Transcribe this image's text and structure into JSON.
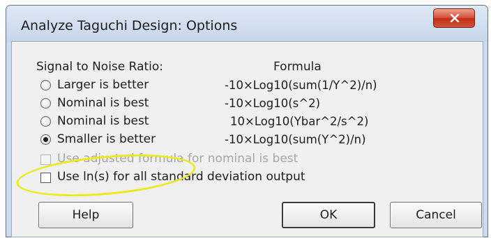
{
  "dialog": {
    "title": "Analyze Taguchi Design: Options"
  },
  "sn_ratio": {
    "heading": "Signal to Noise Ratio:",
    "formula_heading": "Formula",
    "options": [
      {
        "label": "Larger is better",
        "formula": "-10×Log10(sum(1/Y^2)/n)",
        "selected": false
      },
      {
        "label": "Nominal is best",
        "formula": "-10×Log10(s^2)",
        "selected": false
      },
      {
        "label": "Nominal is best",
        "formula": "10×Log10(Ybar^2/s^2)",
        "selected": false
      },
      {
        "label": "Smaller is better",
        "formula": "-10×Log10(sum(Y^2)/n)",
        "selected": true
      }
    ]
  },
  "checkboxes": {
    "adjusted_formula": {
      "label": "Use adjusted formula for nominal is best",
      "checked": false,
      "enabled": false
    },
    "use_ln": {
      "label": "Use ln(s) for all standard deviation output",
      "checked": false,
      "enabled": true
    }
  },
  "buttons": {
    "help": "Help",
    "ok": "OK",
    "cancel": "Cancel"
  },
  "icons": {
    "close": "close-icon"
  },
  "colors": {
    "highlight": "#ecea1c",
    "close_button": "#c8412a"
  }
}
